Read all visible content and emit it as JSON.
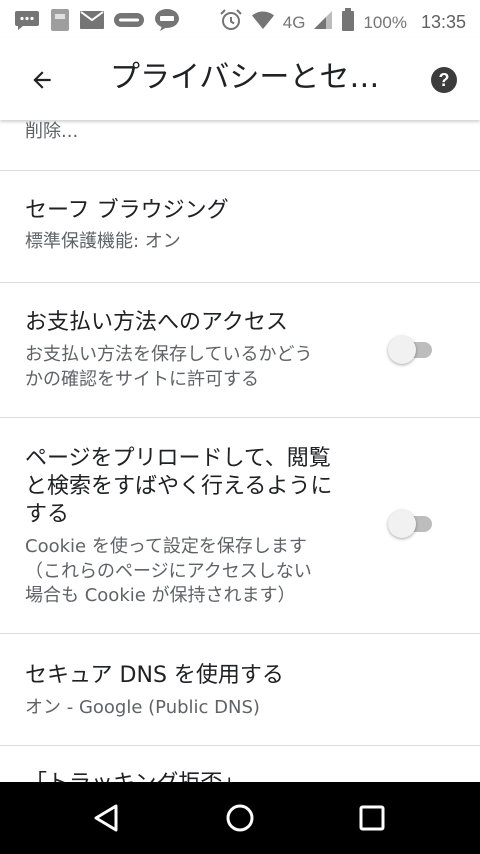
{
  "status_bar": {
    "network": "4G",
    "battery": "100%",
    "time": "13:35",
    "notification_icons": [
      "message-icon",
      "sim-icon",
      "mail-icon",
      "watcha-icon",
      "line-icon"
    ]
  },
  "app_bar": {
    "title": "プライバシーとセ…",
    "back_icon": "arrow-back-icon",
    "help_icon": "help-icon"
  },
  "settings": {
    "partial_top": "削除...",
    "safe_browsing": {
      "title": "セーフ ブラウジング",
      "summary": "標準保護機能: オン"
    },
    "payment_access": {
      "title": "お支払い方法へのアクセス",
      "summary_line1": "お支払い方法を保存しているかどう",
      "summary_line2": "かの確認をサイトに許可する",
      "enabled": false
    },
    "preload": {
      "title_line1": "ページをプリロードして、閲覧",
      "title_line2": "と検索をすばやく行えるように",
      "title_line3": "する",
      "summary_line1": "Cookie を使って設定を保存します",
      "summary_line2": "（これらのページにアクセスしない",
      "summary_line3": "場合も Cookie が保持されます）",
      "enabled": false
    },
    "secure_dns": {
      "title": "セキュア DNS を使用する",
      "summary": "オン - Google (Public DNS)"
    },
    "partial_bottom": "「トラッキング拒否」"
  },
  "nav_bar": {
    "back": "nav-back-icon",
    "home": "nav-home-icon",
    "recents": "nav-recents-icon"
  },
  "colors": {
    "text_primary": "#202124",
    "text_secondary": "#5f6368",
    "divider": "#dadce0",
    "toggle_off_track": "#bdbdbd"
  }
}
